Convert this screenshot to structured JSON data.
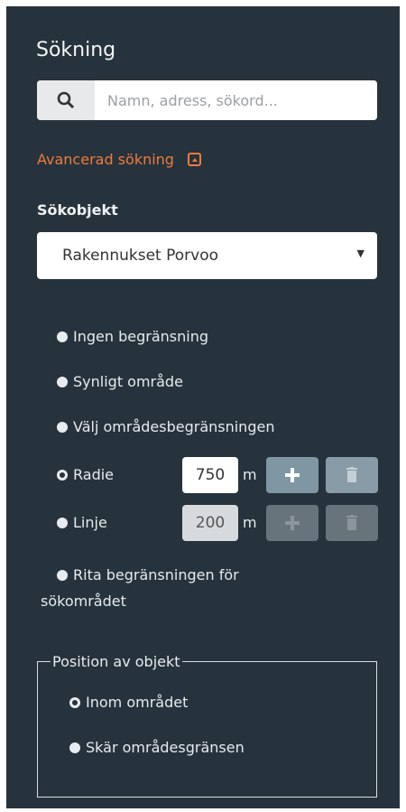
{
  "panel": {
    "title": "Sökning"
  },
  "search": {
    "placeholder": "Namn, adress, sökord..."
  },
  "advanced": {
    "label": "Avancerad sökning"
  },
  "search_object": {
    "label": "Sökobjekt",
    "selected": "Rakennukset Porvoo"
  },
  "limits": {
    "none": "Ingen begränsning",
    "visible": "Synligt område",
    "choose": "Välj områdesbegränsningen",
    "radius": {
      "label": "Radie",
      "value": "750",
      "unit": "m"
    },
    "line": {
      "label": "Linje",
      "value": "200",
      "unit": "m"
    },
    "draw": {
      "line1": "Rita begränsningen för",
      "line2": "sökområdet"
    }
  },
  "position": {
    "legend": "Position av objekt",
    "inside": "Inom området",
    "intersects": "Skär områdesgränsen"
  },
  "colors": {
    "panel": "#26333c",
    "accent": "#ef7a3c"
  }
}
